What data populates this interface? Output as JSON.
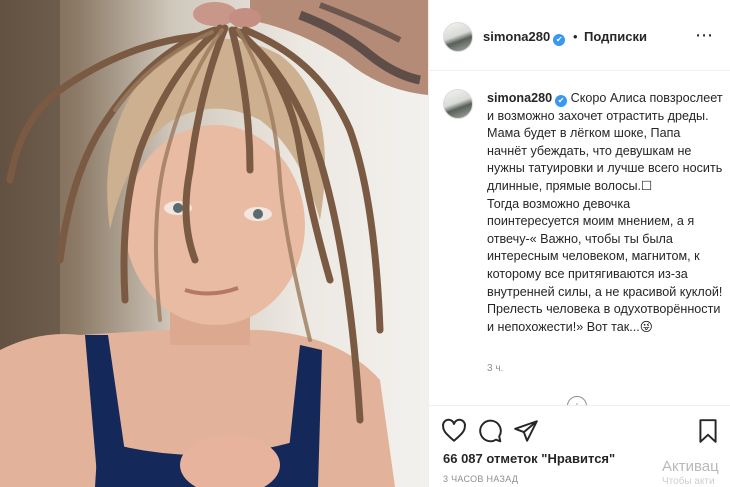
{
  "post": {
    "username": "simona280",
    "verified_mark": "✔",
    "separator": "•",
    "follow_label": "Подписки",
    "more_icon": "⋯",
    "caption_text": " Скоро Алиса повзрослеет и возможно захочет отрастить дреды.\nМама будет в лёгком шоке, Папа начнёт убеждать, что девушкам не нужны татуировки и лучше всего носить длинные, прямые волосы.☐\nТогда возможно девочка поинтересуется моим мнением, а я отвечу-« Важно, чтобы ты была интересным человеком, магнитом, к которому все притягиваются из-за внутренней силы, а не красивой куклой! Прелесть человека в одухотворённости и непохожести!» Вот так...😜",
    "timestamp": "3 ч.",
    "load_more_icon": "+",
    "likes_text": "66 087 отметок \"Нравится\"",
    "time_ago": "3 ЧАСОВ НАЗАД"
  },
  "icons": {
    "like": "heart-icon",
    "comment": "comment-bubble-icon",
    "share": "paper-plane-icon",
    "save": "bookmark-icon",
    "more": "ellipsis-icon"
  },
  "system": {
    "watermark": "Активац",
    "watermark_sub": "Чтобы акти"
  },
  "colors": {
    "text": "#262626",
    "secondary": "#8e8e8e",
    "verified": "#3897f0",
    "border": "#efefef"
  }
}
